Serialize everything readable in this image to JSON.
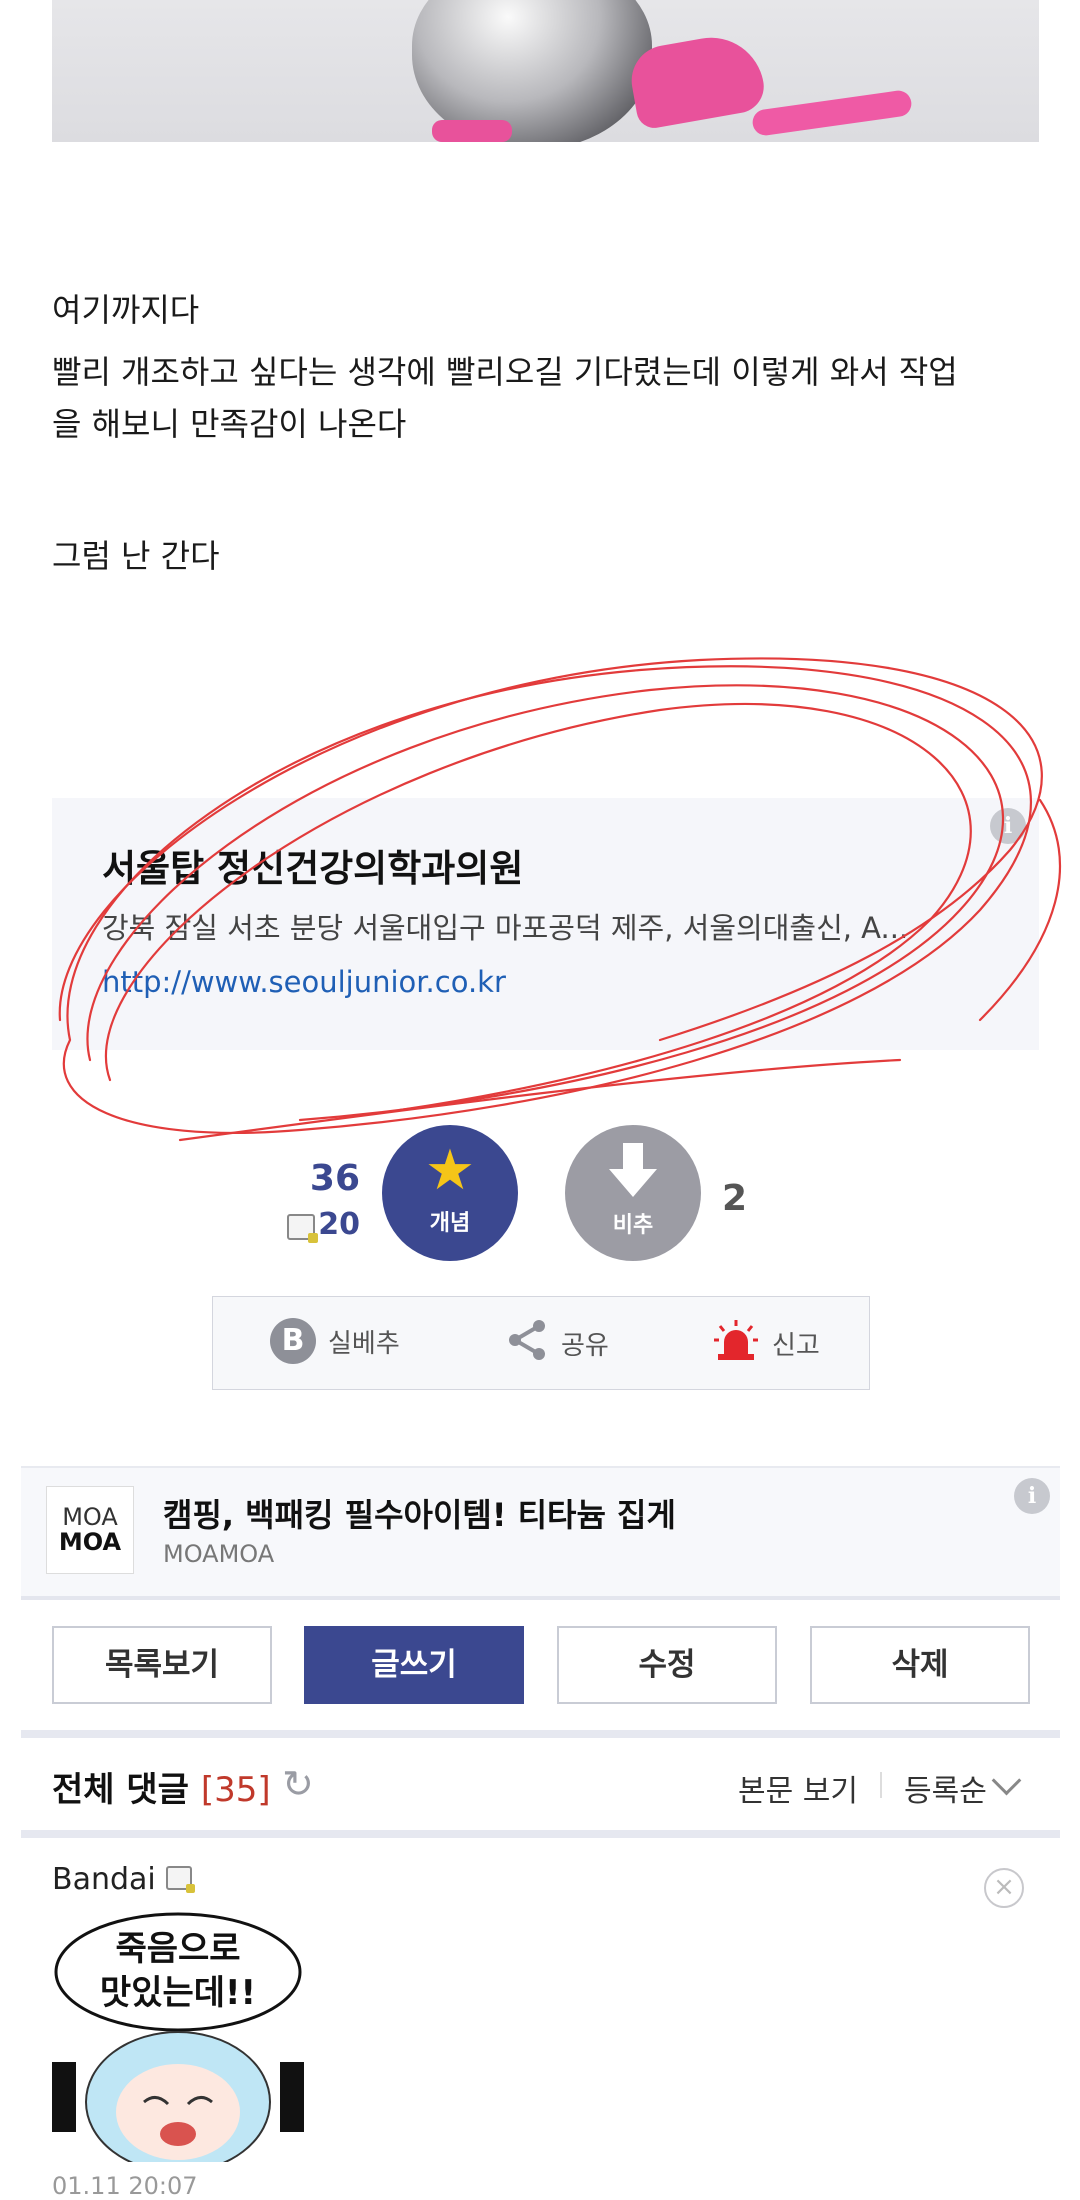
{
  "article": {
    "paragraphs": [
      "여기까지다",
      "빨리 개조하고 싶다는 생각에 빨리오길 기다렸는데 이렇게 와서 작업",
      "을 해보니 만족감이 나온다",
      "그럼 난 간다"
    ]
  },
  "ad1": {
    "title": "서울탑 정신건강의학과의원",
    "description": "강북 잠실 서초 분당 서울대입구 마포공덕 제주, 서울의대출신, A...",
    "url": "http://www.seouljunior.co.kr",
    "info_icon": "i"
  },
  "vote": {
    "up_count": "36",
    "sub_count": "20",
    "up_label": "개념",
    "down_label": "비추",
    "down_count": "2",
    "up_color": "#3b4890",
    "down_color": "#9c9ca4"
  },
  "actions": {
    "best_badge": "B",
    "best_label": "실베추",
    "share_label": "공유",
    "report_label": "신고"
  },
  "ad2": {
    "logo_line1": "MOA",
    "logo_line2": "MOA",
    "title": "캠핑, 백패킹 필수아이템! 티타늄 집게",
    "advertiser": "MOAMOA",
    "info_icon": "i"
  },
  "buttons": {
    "list": "목록보기",
    "write": "글쓰기",
    "edit": "수정",
    "delete": "삭제"
  },
  "comments": {
    "title": "전체 댓글",
    "count": "[35]",
    "view_body": "본문 보기",
    "sort": "등록순",
    "items": [
      {
        "user": "Bandai",
        "sticker_text_line1": "죽음으로",
        "sticker_text_line2": "맛있는데!!",
        "date": "01.11 20:07"
      }
    ]
  }
}
